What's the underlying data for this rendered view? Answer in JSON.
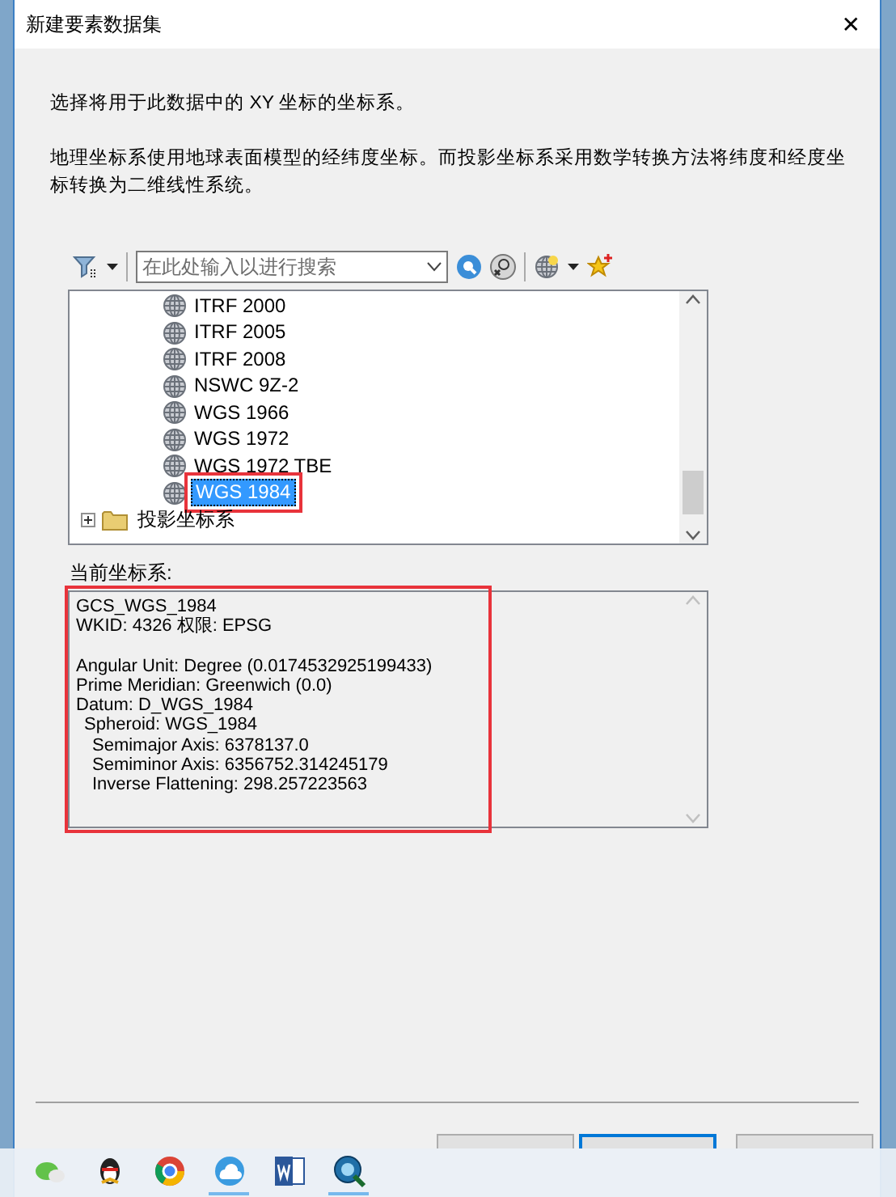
{
  "window": {
    "title": "新建要素数据集",
    "close": "✕"
  },
  "instructions": [
    "选择将用于此数据中的 XY 坐标的坐标系。",
    "地理坐标系使用地球表面模型的经纬度坐标。而投影坐标系采用数学转换方法将纬度和经度坐标转换为二维线性系统。"
  ],
  "search": {
    "placeholder": "在此处输入以进行搜索"
  },
  "tree": {
    "items": [
      {
        "label": "ITRF 2000",
        "selected": false,
        "annotated": false
      },
      {
        "label": "ITRF 2005",
        "selected": false,
        "annotated": false
      },
      {
        "label": "ITRF 2008",
        "selected": false,
        "annotated": false
      },
      {
        "label": "NSWC 9Z-2",
        "selected": false,
        "annotated": false
      },
      {
        "label": "WGS 1966",
        "selected": false,
        "annotated": false
      },
      {
        "label": "WGS 1972",
        "selected": false,
        "annotated": false
      },
      {
        "label": "WGS 1972 TBE",
        "selected": false,
        "annotated": false
      },
      {
        "label": "WGS 1984",
        "selected": true,
        "annotated": true
      }
    ],
    "folder": {
      "label": "投影坐标系",
      "expanded": false
    }
  },
  "current": {
    "label": "当前坐标系:",
    "annotated": true,
    "blocks": [
      [
        {
          "text": "GCS_WGS_1984"
        },
        {
          "text": "WKID: 4326 权限: EPSG"
        }
      ],
      [
        {
          "text": "Angular Unit: Degree (0.0174532925199433)"
        },
        {
          "text": "Prime Meridian: Greenwich (0.0)"
        },
        {
          "text": "Datum: D_WGS_1984",
          "children": [
            {
              "text": "Spheroid: WGS_1984",
              "children": [
                {
                  "text": "Semimajor Axis: 6378137.0"
                },
                {
                  "text": "Semiminor Axis: 6356752.314245179"
                },
                {
                  "text": "Inverse Flattening: 298.257223563"
                }
              ]
            }
          ]
        }
      ]
    ]
  },
  "buttons": [
    {
      "default": false
    },
    {
      "default": true
    },
    {
      "default": false
    }
  ],
  "taskbar": [
    {
      "kind": "chat",
      "running": false
    },
    {
      "kind": "penguin",
      "running": false
    },
    {
      "kind": "browser",
      "running": false
    },
    {
      "kind": "cloud",
      "running": true
    },
    {
      "kind": "word",
      "running": false
    },
    {
      "kind": "globe-search",
      "running": true
    }
  ]
}
